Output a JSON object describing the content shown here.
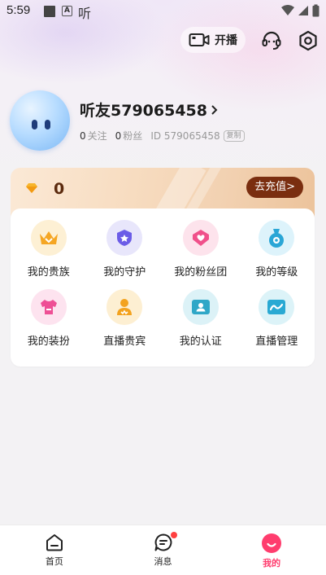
{
  "status_bar": {
    "time": "5:59",
    "notification_text": "听"
  },
  "header": {
    "live_button_label": "开播"
  },
  "profile": {
    "username": "听友579065458",
    "follow_count": "0",
    "follow_label": "关注",
    "fans_count": "0",
    "fans_label": "粉丝",
    "id_text": "ID 579065458",
    "copy_label": "复制"
  },
  "wallet": {
    "balance": "0",
    "recharge_label": "去充值>"
  },
  "features": [
    {
      "label": "我的贵族",
      "icon": "crown-icon",
      "bg": "#fdf0d4",
      "color": "#f5a623"
    },
    {
      "label": "我的守护",
      "icon": "shield-icon",
      "bg": "#e8e6fb",
      "color": "#6b5ce7"
    },
    {
      "label": "我的粉丝团",
      "icon": "fan-club-icon",
      "bg": "#fde3ec",
      "color": "#f0508a"
    },
    {
      "label": "我的等级",
      "icon": "level-icon",
      "bg": "#ddf3fb",
      "color": "#2aa6d6"
    },
    {
      "label": "我的装扮",
      "icon": "outfit-icon",
      "bg": "#fde3ef",
      "color": "#ee4f95"
    },
    {
      "label": "直播贵宾",
      "icon": "vip-guest-icon",
      "bg": "#fdefd2",
      "color": "#f3a21e"
    },
    {
      "label": "我的认证",
      "icon": "id-card-icon",
      "bg": "#dcf2f7",
      "color": "#2fa7c7"
    },
    {
      "label": "直播管理",
      "icon": "live-manage-icon",
      "bg": "#dcf3f8",
      "color": "#29a9d3"
    }
  ],
  "bottom_nav": [
    {
      "label": "首页",
      "icon": "home-icon"
    },
    {
      "label": "消息",
      "icon": "message-icon"
    },
    {
      "label": "我的",
      "icon": "profile-icon"
    }
  ],
  "colors": {
    "accent": "#ff3d6e",
    "recharge_bg": "#7a2e10",
    "balance_text": "#5b2a0e"
  }
}
